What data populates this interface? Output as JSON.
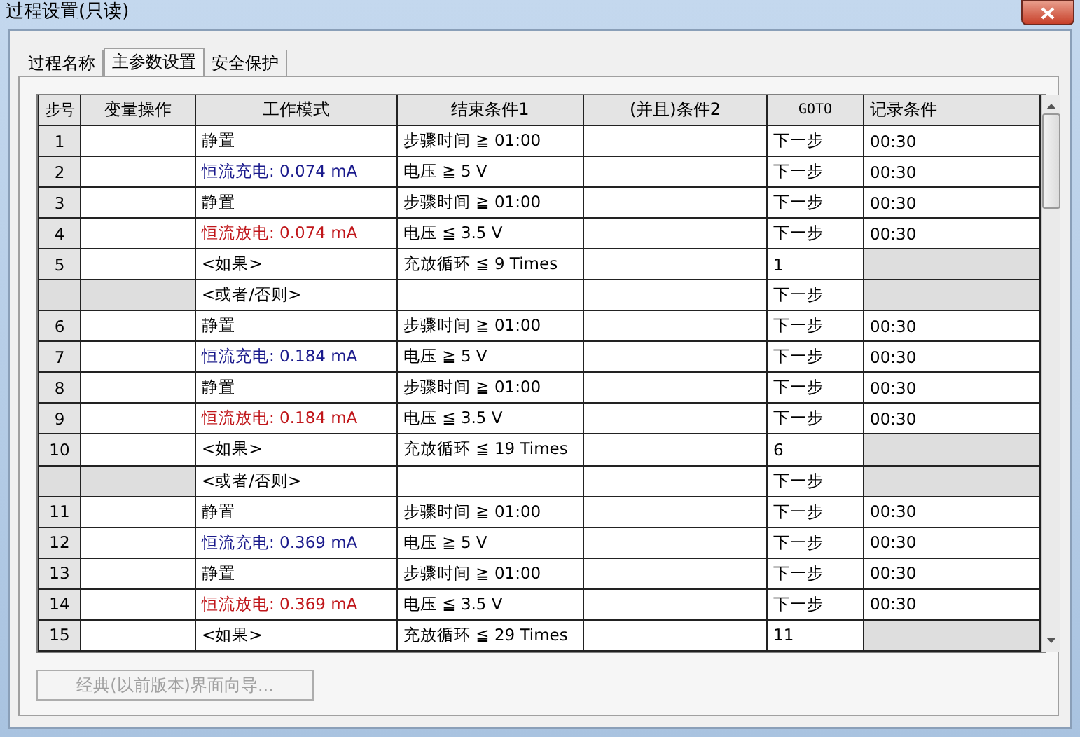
{
  "window": {
    "title": "过程设置(只读)"
  },
  "tabs": [
    {
      "label": "过程名称",
      "selected": false
    },
    {
      "label": "主参数设置",
      "selected": true
    },
    {
      "label": "安全保护",
      "selected": false
    }
  ],
  "table": {
    "columns": [
      "步号",
      "变量操作",
      "工作模式",
      "结束条件1",
      "(并且)条件2",
      "GOTO",
      "记录条件"
    ],
    "rows": [
      {
        "kind": "step",
        "step": "1",
        "mode": "静置",
        "color": "#000000",
        "end1": "步骤时间 ≧ 01:00",
        "goto": "下一步",
        "record": "00:30"
      },
      {
        "kind": "step",
        "step": "2",
        "mode": "恒流充电: 0.074 mA",
        "color": "#1a1a8c",
        "end1": "电压 ≧ 5 V",
        "goto": "下一步",
        "record": "00:30"
      },
      {
        "kind": "step",
        "step": "3",
        "mode": "静置",
        "color": "#000000",
        "end1": "步骤时间 ≧ 01:00",
        "goto": "下一步",
        "record": "00:30"
      },
      {
        "kind": "step",
        "step": "4",
        "mode": "恒流放电: 0.074 mA",
        "color": "#c0161a",
        "end1": "电压 ≦ 3.5 V",
        "goto": "下一步",
        "record": "00:30"
      },
      {
        "kind": "if",
        "step": "5",
        "mode": "<如果>",
        "color": "#000000",
        "end1": "充放循环 ≦ 9 Times",
        "goto": "1"
      },
      {
        "kind": "else",
        "mode": "<或者/否则>",
        "color": "#000000",
        "goto": "下一步"
      },
      {
        "kind": "step",
        "step": "6",
        "mode": "静置",
        "color": "#000000",
        "end1": "步骤时间 ≧ 01:00",
        "goto": "下一步",
        "record": "00:30"
      },
      {
        "kind": "step",
        "step": "7",
        "mode": "恒流充电: 0.184 mA",
        "color": "#1a1a8c",
        "end1": "电压 ≧ 5 V",
        "goto": "下一步",
        "record": "00:30"
      },
      {
        "kind": "step",
        "step": "8",
        "mode": "静置",
        "color": "#000000",
        "end1": "步骤时间 ≧ 01:00",
        "goto": "下一步",
        "record": "00:30"
      },
      {
        "kind": "step",
        "step": "9",
        "mode": "恒流放电: 0.184 mA",
        "color": "#c0161a",
        "end1": "电压 ≦ 3.5 V",
        "goto": "下一步",
        "record": "00:30"
      },
      {
        "kind": "if",
        "step": "10",
        "mode": "<如果>",
        "color": "#000000",
        "end1": "充放循环 ≦ 19 Times",
        "goto": "6"
      },
      {
        "kind": "else",
        "mode": "<或者/否则>",
        "color": "#000000",
        "goto": "下一步"
      },
      {
        "kind": "step",
        "step": "11",
        "mode": "静置",
        "color": "#000000",
        "end1": "步骤时间 ≧ 01:00",
        "goto": "下一步",
        "record": "00:30"
      },
      {
        "kind": "step",
        "step": "12",
        "mode": "恒流充电: 0.369 mA",
        "color": "#1a1a8c",
        "end1": "电压 ≧ 5 V",
        "goto": "下一步",
        "record": "00:30"
      },
      {
        "kind": "step",
        "step": "13",
        "mode": "静置",
        "color": "#000000",
        "end1": "步骤时间 ≧ 01:00",
        "goto": "下一步",
        "record": "00:30"
      },
      {
        "kind": "step",
        "step": "14",
        "mode": "恒流放电: 0.369 mA",
        "color": "#c0161a",
        "end1": "电压 ≦ 3.5 V",
        "goto": "下一步",
        "record": "00:30"
      },
      {
        "kind": "if",
        "step": "15",
        "mode": "<如果>",
        "color": "#000000",
        "end1": "充放循环 ≦ 29 Times",
        "goto": "11"
      }
    ]
  },
  "wizard_button": {
    "label": "经典(以前版本)界面向导...",
    "disabled": true
  }
}
